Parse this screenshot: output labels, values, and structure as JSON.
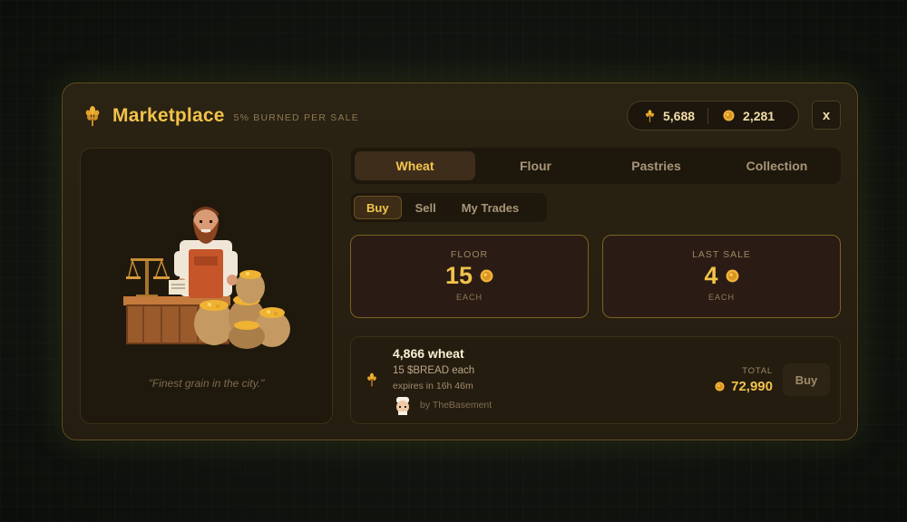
{
  "header": {
    "title": "Marketplace",
    "subtitle": "5% BURNED PER SALE",
    "icon": "wheat-icon"
  },
  "balances": [
    {
      "icon": "wheat-icon",
      "value": "5,688"
    },
    {
      "icon": "coin-icon",
      "value": "2,281"
    }
  ],
  "close_label": "x",
  "merchant_card": {
    "quote": "\"Finest grain in the city.\""
  },
  "tabs": [
    {
      "label": "Wheat",
      "active": true
    },
    {
      "label": "Flour",
      "active": false
    },
    {
      "label": "Pastries",
      "active": false
    },
    {
      "label": "Collection",
      "active": false
    }
  ],
  "subtabs": [
    {
      "label": "Buy",
      "active": true
    },
    {
      "label": "Sell",
      "active": false
    },
    {
      "label": "My Trades",
      "active": false
    }
  ],
  "stats": {
    "floor": {
      "label": "FLOOR",
      "value": "15",
      "sub": "EACH"
    },
    "last_sale": {
      "label": "LAST SALE",
      "value": "4",
      "sub": "EACH"
    }
  },
  "listing": {
    "title": "4,866 wheat",
    "price": "15 $BREAD each",
    "expires": "expires in 16h 46m",
    "seller": "by TheBasement",
    "total_label": "TOTAL",
    "total": "72,990",
    "buy_label": "Buy"
  },
  "colors": {
    "accent": "#f1c24a",
    "panel": "#251d10",
    "border": "#7a6322"
  }
}
